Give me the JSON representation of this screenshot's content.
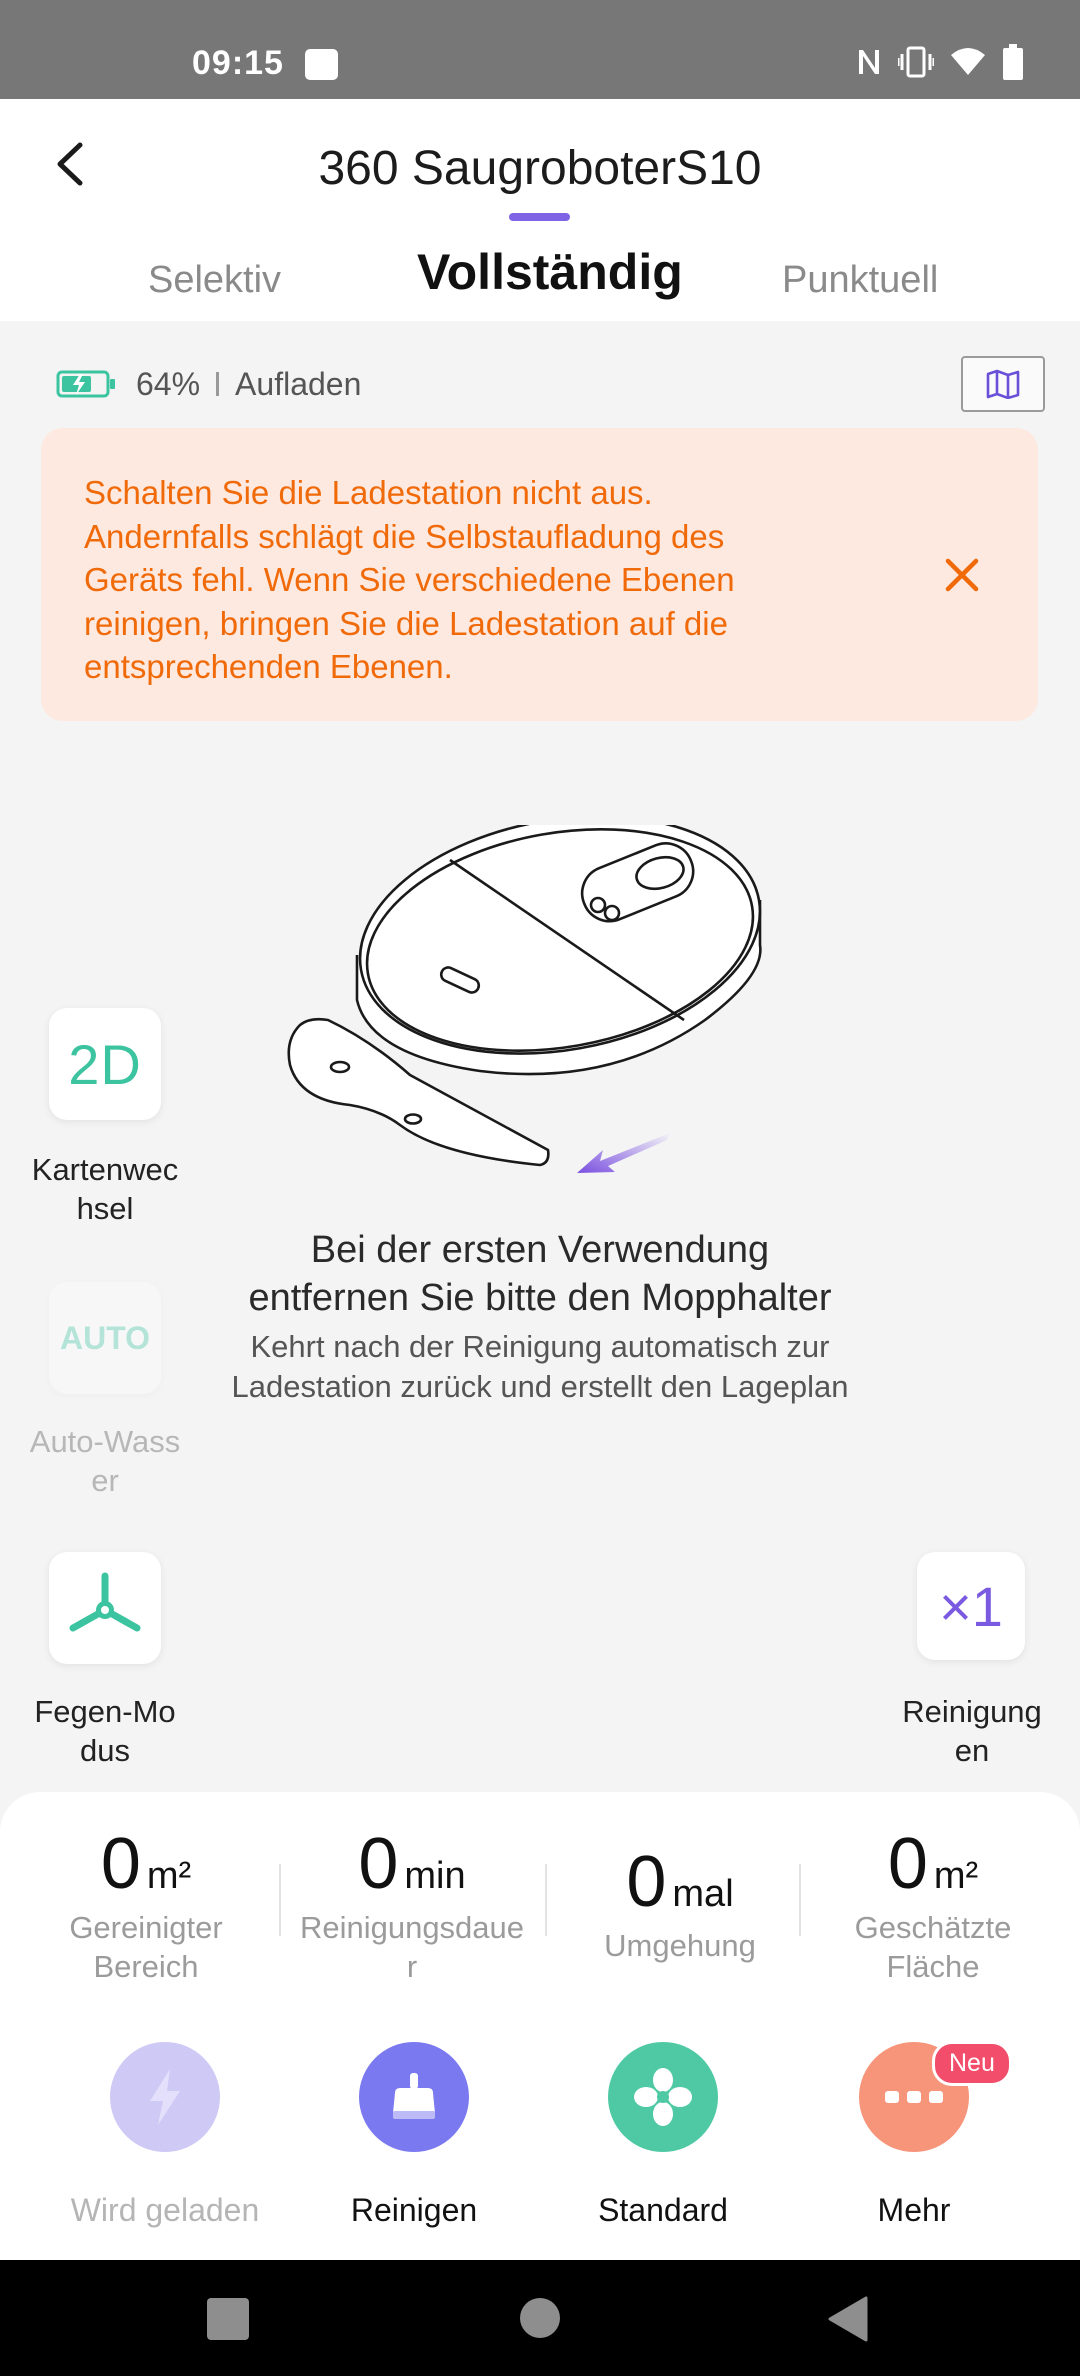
{
  "status_bar": {
    "time": "09:15",
    "icons": [
      "nfc-icon",
      "vibrate-icon",
      "wifi-icon",
      "battery-icon"
    ]
  },
  "header": {
    "title": "360 SaugroboterS10",
    "tabs": [
      {
        "label": "Selektiv",
        "active": false
      },
      {
        "label": "Vollständig",
        "active": true
      },
      {
        "label": "Punktuell",
        "active": false
      }
    ]
  },
  "battery": {
    "percent": "64%",
    "status": "Aufladen",
    "level": 0.64
  },
  "warning": {
    "lines": [
      "Schalten Sie die Ladestation nicht aus.",
      "Andernfalls schlägt die Selbstaufladung des",
      "Geräts fehl. Wenn Sie verschiedene Ebenen",
      "reinigen, bringen Sie die Ladestation auf die",
      "entsprechenden Ebenen."
    ]
  },
  "hint": {
    "title_lines": [
      "Bei der ersten Verwendung",
      "entfernen Sie bitte den Mopphalter"
    ],
    "sub_lines": [
      "Kehrt nach der Reinigung automatisch zur",
      "Ladestation zurück und erstellt den Lageplan"
    ]
  },
  "side_controls": {
    "map_switch": {
      "icon_text": "2D",
      "label_lines": [
        "Kartenwec",
        "hsel"
      ]
    },
    "auto_water": {
      "icon_text": "AUTO",
      "label_lines": [
        "Auto-Wass",
        "er"
      ],
      "disabled": true
    },
    "sweep_mode": {
      "icon": "brush-icon",
      "label_lines": [
        "Fegen-Mo",
        "dus"
      ]
    },
    "cleanings": {
      "icon_text": "×1",
      "label_lines": [
        "Reinigung",
        "en"
      ]
    }
  },
  "stats": [
    {
      "value": "0",
      "unit": "m²",
      "label_lines": [
        "Gereinigter",
        "Bereich"
      ]
    },
    {
      "value": "0",
      "unit": "min",
      "label_lines": [
        "Reinigungsdaue",
        "r"
      ]
    },
    {
      "value": "0",
      "unit": "mal",
      "label_lines": [
        "Umgehung"
      ]
    },
    {
      "value": "0",
      "unit": "m²",
      "label_lines": [
        "Geschätzte",
        "Fläche"
      ]
    }
  ],
  "actions": [
    {
      "label": "Wird geladen",
      "icon": "lightning-icon",
      "color": "#cfc9f5",
      "disabled": true
    },
    {
      "label": "Reinigen",
      "icon": "clean-icon",
      "color": "#7b79f0"
    },
    {
      "label": "Standard",
      "icon": "fan-icon",
      "color": "#4fc9a3"
    },
    {
      "label": "Mehr",
      "icon": "more-icon",
      "color": "#f7957a",
      "badge": "Neu"
    }
  ],
  "colors": {
    "accent": "#7e63e4",
    "warning_text": "#f06a0a",
    "warning_bg": "#fde9df",
    "teal": "#3cc4a0"
  }
}
